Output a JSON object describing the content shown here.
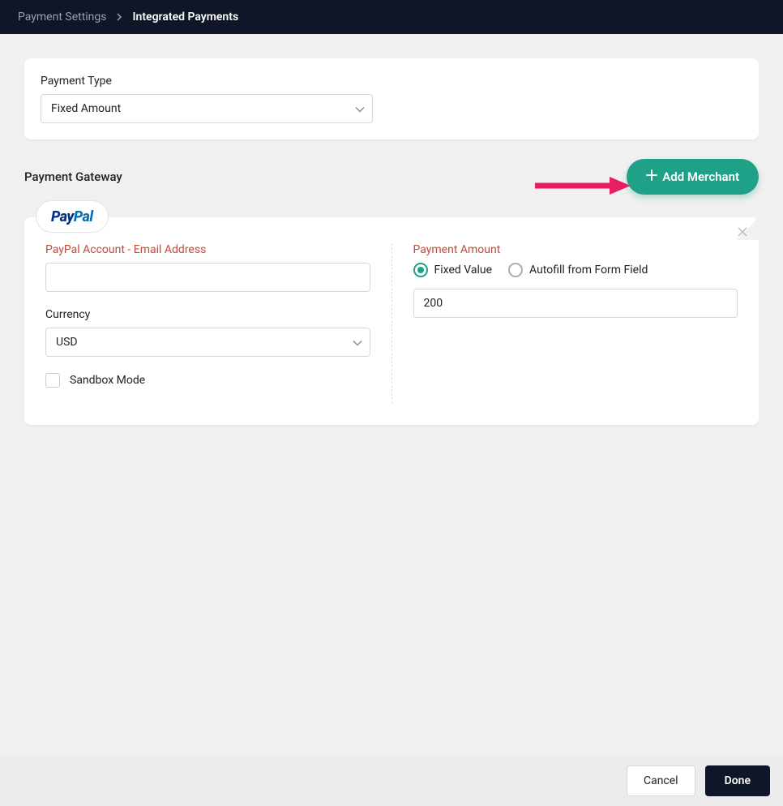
{
  "breadcrumb": {
    "parent": "Payment Settings",
    "current": "Integrated Payments"
  },
  "paymentType": {
    "label": "Payment Type",
    "value": "Fixed Amount"
  },
  "gateway": {
    "sectionTitle": "Payment Gateway",
    "addButton": "Add Merchant",
    "providerLabelA": "Pay",
    "providerLabelB": "Pal",
    "account": {
      "label": "PayPal Account - Email Address",
      "value": ""
    },
    "currency": {
      "label": "Currency",
      "value": "USD"
    },
    "sandbox": {
      "label": "Sandbox Mode",
      "checked": false
    },
    "amount": {
      "label": "Payment Amount",
      "options": [
        "Fixed Value",
        "Autofill from Form Field"
      ],
      "selected": "Fixed Value",
      "value": "200"
    }
  },
  "footer": {
    "cancel": "Cancel",
    "done": "Done"
  },
  "colors": {
    "accent": "#1ea186",
    "header": "#0e1628",
    "sectionLabel": "#c24a3b",
    "arrow": "#e81e63"
  }
}
